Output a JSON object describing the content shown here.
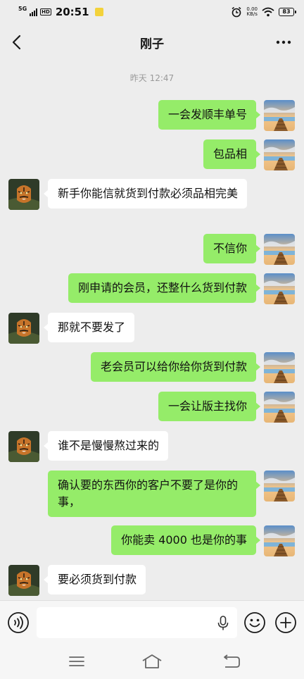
{
  "status_bar": {
    "network": "5G",
    "hd": "HD",
    "time": "20:51",
    "net_speed_value": "0.00",
    "net_speed_unit": "KB/s",
    "battery": "83"
  },
  "nav": {
    "title": "刚子",
    "back_icon": "chevron-left-icon",
    "more_icon": "more-dots-icon"
  },
  "timestamp": "昨天 12:47",
  "messages": [
    {
      "side": "sent",
      "text": "一会发顺丰单号"
    },
    {
      "side": "sent",
      "text": "包品相"
    },
    {
      "side": "recv",
      "text": "新手你能信就货到付款必须品相完美"
    },
    {
      "side": "sent",
      "text": "不信你"
    },
    {
      "side": "sent",
      "text": "刚申请的会员，还整什么货到付款"
    },
    {
      "side": "recv",
      "text": "那就不要发了"
    },
    {
      "side": "sent",
      "text": "老会员可以给你给你货到付款"
    },
    {
      "side": "sent",
      "text": "一会让版主找你"
    },
    {
      "side": "recv",
      "text": "谁不是慢慢熬过来的"
    },
    {
      "side": "sent",
      "text": "确认要的东西你的客户不要了是你的事，"
    },
    {
      "side": "sent",
      "text": "你能卖 4000 也是你的事"
    },
    {
      "side": "recv",
      "text": "要必须货到付款"
    }
  ],
  "input_bar": {
    "placeholder": "",
    "voice_icon": "voice-icon",
    "mic_icon": "mic-icon",
    "emoji_icon": "emoji-icon",
    "plus_icon": "plus-icon"
  },
  "colors": {
    "sent_bubble": "#95ec69",
    "recv_bubble": "#ffffff",
    "background": "#ededed"
  }
}
